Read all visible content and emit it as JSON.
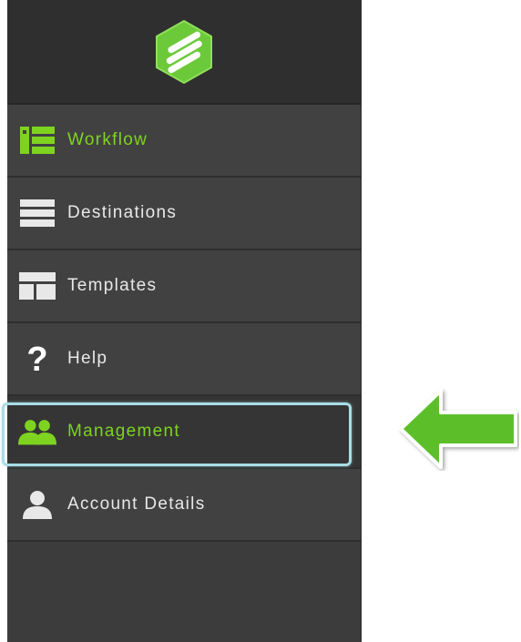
{
  "sidebar": {
    "logo": "brand-logo",
    "items": [
      {
        "label": "Workflow",
        "icon": "workflow-icon",
        "active": true
      },
      {
        "label": "Destinations",
        "icon": "list-icon",
        "active": false
      },
      {
        "label": "Templates",
        "icon": "template-icon",
        "active": false
      },
      {
        "label": "Help",
        "icon": "question-icon",
        "active": false
      },
      {
        "label": "Management",
        "icon": "users-icon",
        "active": false,
        "highlighted": true
      },
      {
        "label": "Account Details",
        "icon": "user-icon",
        "active": false
      }
    ]
  },
  "annotation": {
    "arrow": "pointer-arrow",
    "color": "#5cbf2a"
  },
  "colors": {
    "accent": "#7ed321",
    "sidebar_bg": "#414141",
    "highlight_border": "#a8dde6"
  }
}
